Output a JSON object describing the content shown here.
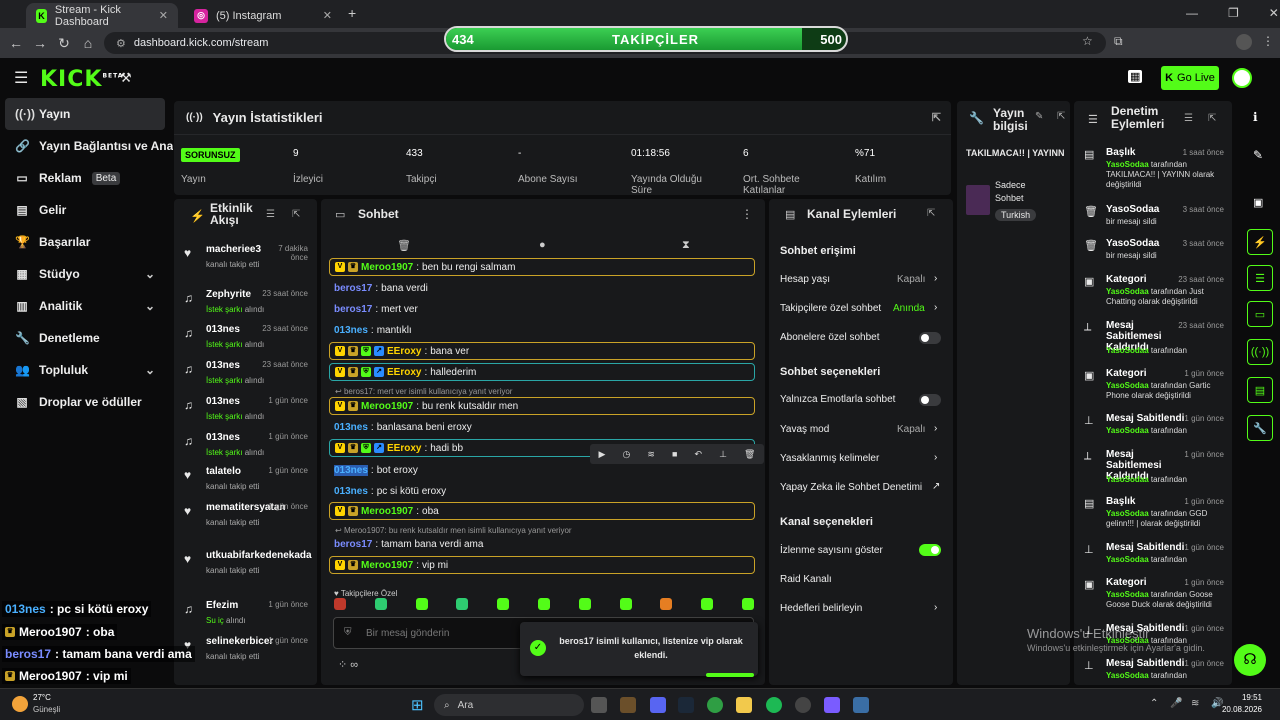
{
  "browser": {
    "tabs": [
      {
        "label": "Stream - Kick Dashboard",
        "fav": "K"
      },
      {
        "label": "(5) Instagram",
        "fav": "◎"
      }
    ],
    "url": "dashboard.kick.com/stream",
    "new_tab": "+"
  },
  "follow_bar": {
    "current": "434",
    "label": "TAKİPÇİLER",
    "goal": "500",
    "progress": 0.89
  },
  "header": {
    "logo": "KICK",
    "logo_tag": "BETA",
    "go_live": "Go Live"
  },
  "sidebar": {
    "items": [
      {
        "label": "Yayın",
        "icon": "broadcast-icon"
      },
      {
        "label": "Yayın Bağlantısı ve Anahtar",
        "icon": "link-icon"
      },
      {
        "label": "Reklam",
        "icon": "ad-icon",
        "badge": "Beta"
      },
      {
        "label": "Gelir",
        "icon": "money-icon"
      },
      {
        "label": "Başarılar",
        "icon": "trophy-icon"
      },
      {
        "label": "Stüdyo",
        "icon": "studio-icon"
      },
      {
        "label": "Analitik",
        "icon": "analytics-icon"
      },
      {
        "label": "Denetleme",
        "icon": "wrench-icon"
      },
      {
        "label": "Topluluk",
        "icon": "community-icon"
      },
      {
        "label": "Droplar ve ödüller",
        "icon": "drops-icon"
      }
    ]
  },
  "stats": {
    "title": "Yayın İstatistikleri",
    "items": [
      {
        "value": "SORUNSUZ",
        "label": "Yayın"
      },
      {
        "value": "9",
        "label": "İzleyici"
      },
      {
        "value": "433",
        "label": "Takipçi"
      },
      {
        "value": "-",
        "label": "Abone Sayısı"
      },
      {
        "value": "01:18:56",
        "label": "Yayında Olduğu Süre"
      },
      {
        "value": "6",
        "label": "Ort. Sohbete Katılanlar"
      },
      {
        "value": "%71",
        "label": "Katılım"
      }
    ]
  },
  "stream_info": {
    "title": "Yayın bilgisi",
    "stream_title": "TAKILMACA!! | YAYINN",
    "category": "Sadece Sohbet",
    "tag": "Turkish"
  },
  "activity": {
    "title": "Etkinlik Akışı",
    "items": [
      {
        "name": "macheriee3",
        "sub": "kanalı takip etti",
        "time": "7 dakika önce",
        "type": "follow"
      },
      {
        "name": "Zephyrite",
        "sub": "İstek şarkı",
        "sub2": "alındı",
        "time": "23 saat önce",
        "type": "song"
      },
      {
        "name": "013nes",
        "sub": "İstek şarkı",
        "sub2": "alındı",
        "time": "23 saat önce",
        "type": "song"
      },
      {
        "name": "013nes",
        "sub": "İstek şarkı",
        "sub2": "alındı",
        "time": "23 saat önce",
        "type": "song"
      },
      {
        "name": "013nes",
        "sub": "İstek şarkı",
        "sub2": "alındı",
        "time": "1 gün önce",
        "type": "song"
      },
      {
        "name": "013nes",
        "sub": "İstek şarkı",
        "sub2": "alındı",
        "time": "1 gün önce",
        "type": "song"
      },
      {
        "name": "talatelo",
        "sub": "kanalı takip etti",
        "time": "1 gün önce",
        "type": "follow"
      },
      {
        "name": "mematitersyatan",
        "sub": "kanalı takip etti",
        "time": "1 gün önce",
        "type": "follow"
      },
      {
        "name": "utkuabifarkedenekada",
        "sub": "kanalı takip etti",
        "time": "",
        "type": "follow"
      },
      {
        "name": "Efezim",
        "sub": "Su iç",
        "sub2": "alındı",
        "time": "1 gün önce",
        "type": "song"
      },
      {
        "name": "selinekerbicer",
        "sub": "kanalı takip etti",
        "time": "1 gün önce",
        "type": "follow"
      }
    ]
  },
  "chat": {
    "title": "Sohbet",
    "messages": [
      {
        "user": "Meroo1907",
        "text": "ben bu rengi salmam",
        "color": "#53fc18",
        "style": "box"
      },
      {
        "user": "beros17",
        "text": "bana verdi",
        "color": "#7a8cff",
        "style": ""
      },
      {
        "user": "beros17",
        "text": "mert ver",
        "color": "#7a8cff",
        "style": ""
      },
      {
        "user": "013nes",
        "text": "mantıklı",
        "color": "#4ab0ff",
        "style": ""
      },
      {
        "user": "EEroxy",
        "text": "bana ver",
        "color": "#ffd400",
        "style": "box"
      },
      {
        "user": "EEroxy",
        "text": "hallederim",
        "color": "#ffd400",
        "style": "box2"
      },
      {
        "user": "Meroo1907",
        "text": "bu renk kutsaldır men",
        "color": "#53fc18",
        "style": "box"
      },
      {
        "user": "013nes",
        "text": "banlasana beni eroxy",
        "color": "#4ab0ff",
        "style": ""
      },
      {
        "user": "EEroxy",
        "text": "hadi bb",
        "color": "#ffd400",
        "style": "box2"
      },
      {
        "user": "013nes",
        "text": "bot eroxy",
        "color": "#4ab0ff",
        "style": ""
      },
      {
        "user": "013nes",
        "text": "pc si kötü eroxy",
        "color": "#4ab0ff",
        "style": ""
      },
      {
        "user": "Meroo1907",
        "text": "oba",
        "color": "#53fc18",
        "style": "box"
      },
      {
        "user": "beros17",
        "text": "tamam bana verdi ama",
        "color": "#7a8cff",
        "style": ""
      },
      {
        "user": "Meroo1907",
        "text": "vip mi",
        "color": "#53fc18",
        "style": "box"
      }
    ],
    "replies": [
      "beros17: mert ver isimli kullanıcıya yanıt veriyor",
      "Meroo1907: bu renk kutsaldır men isimli kullanıcıya yanıt veriyor"
    ],
    "followers_only": "Takipçilere Özel",
    "placeholder": "Bir mesaj gönderin",
    "toast": "beros17 isimli kullanıcı, listenize vip olarak eklendi."
  },
  "channel_actions": {
    "title": "Kanal Eylemleri",
    "section1": "Sohbet erişimi",
    "hesap_yasi": "Hesap yaşı",
    "hesap_val": "Kapalı",
    "takipci": "Takipçilere özel sohbet",
    "takipci_val": "Anında",
    "abone": "Abonelere özel sohbet",
    "section2": "Sohbet seçenekleri",
    "emote": "Yalnızca Emotlarla sohbet",
    "yavas": "Yavaş mod",
    "yavas_val": "Kapalı",
    "yasak": "Yasaklanmış kelimeler",
    "ai": "Yapay Zeka ile Sohbet Denetimi",
    "section3": "Kanal seçenekleri",
    "izlenme": "İzlenme sayısını göster",
    "raid": "Raid Kanalı",
    "hedef": "Hedefleri belirleyin"
  },
  "mod_actions": {
    "title": "Denetim Eylemleri",
    "items": [
      {
        "t": "Başlık",
        "time": "1 saat önce",
        "user": "YasoSodaa",
        "d": "tarafından TAKILMACA!! | YAYINN olarak değiştirildi",
        "icon": "title-icon"
      },
      {
        "t": "YasoSodaa",
        "time": "3 saat önce",
        "user": "",
        "d": "bir mesajı sildi",
        "icon": "trash-icon"
      },
      {
        "t": "YasoSodaa",
        "time": "3 saat önce",
        "user": "",
        "d": "bir mesajı sildi",
        "icon": "trash-icon"
      },
      {
        "t": "Kategori",
        "time": "23 saat önce",
        "user": "YasoSodaa",
        "d": "tarafından Just Chatting olarak değiştirildi",
        "icon": "category-icon"
      },
      {
        "t": "Mesaj Sabitlemesi Kaldırıldı",
        "time": "23 saat önce",
        "user": "YasoSodaa",
        "d": "tarafından",
        "icon": "unpin-icon"
      },
      {
        "t": "Kategori",
        "time": "1 gün önce",
        "user": "YasoSodaa",
        "d": "tarafından Gartic Phone olarak değiştirildi",
        "icon": "category-icon"
      },
      {
        "t": "Mesaj Sabitlendi",
        "time": "1 gün önce",
        "user": "YasoSodaa",
        "d": "tarafından",
        "icon": "pin-icon"
      },
      {
        "t": "Mesaj Sabitlemesi Kaldırıldı",
        "time": "1 gün önce",
        "user": "YasoSodaa",
        "d": "tarafından",
        "icon": "unpin-icon"
      },
      {
        "t": "Başlık",
        "time": "1 gün önce",
        "user": "YasoSodaa",
        "d": "tarafından GGD gelinn!!! | olarak değiştirildi",
        "icon": "title-icon"
      },
      {
        "t": "Mesaj Sabitlendi",
        "time": "1 gün önce",
        "user": "YasoSodaa",
        "d": "tarafından",
        "icon": "pin-icon"
      },
      {
        "t": "Kategori",
        "time": "1 gün önce",
        "user": "YasoSodaa",
        "d": "tarafından Goose Goose Duck olarak değiştirildi",
        "icon": "category-icon"
      },
      {
        "t": "Mesaj Sabitlendi",
        "time": "1 gün önce",
        "user": "YasoSodaa",
        "d": "tarafından",
        "icon": "pin-icon"
      },
      {
        "t": "Mesaj Sabitlendi",
        "time": "1 gün önce",
        "user": "YasoSodaa",
        "d": "tarafından",
        "icon": "pin-icon"
      }
    ]
  },
  "overlay": [
    {
      "user": "013nes",
      "text": ": pc si kötü eroxy",
      "color": "#4ab0ff"
    },
    {
      "user": "Meroo1907",
      "text": " : oba",
      "color": "#fff"
    },
    {
      "user": "beros17",
      "text": " : tamam bana verdi ama",
      "color": "#7a8cff"
    },
    {
      "user": "Meroo1907",
      "text": " : vip mi",
      "color": "#fff"
    }
  ],
  "watermark": {
    "line1": "Windows'u Etkinleştir",
    "line2": "Windows'u etkinleştirmek için Ayarlar'a gidin."
  },
  "taskbar": {
    "weather_temp": "27°C",
    "weather_desc": "Güneşli",
    "search": "Ara",
    "time": "19:51",
    "date": "20.08.2026"
  }
}
